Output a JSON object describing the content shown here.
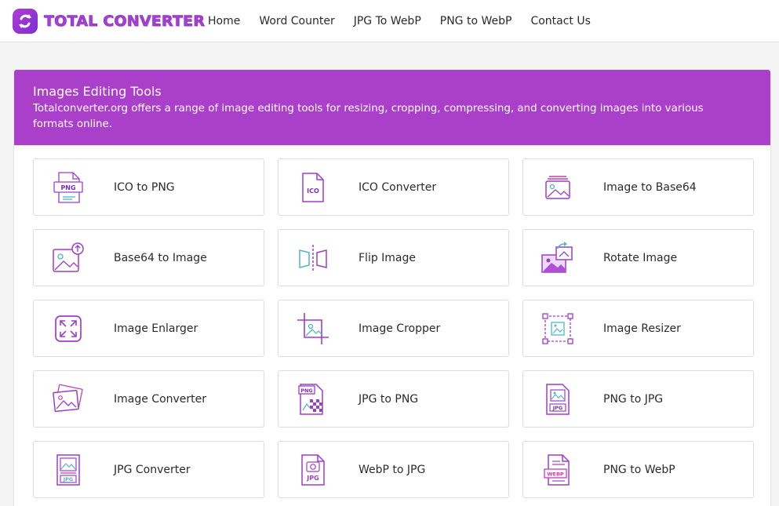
{
  "brand": {
    "name": "TOTAL CONVERTER"
  },
  "nav": [
    {
      "label": "Home"
    },
    {
      "label": "Word Counter"
    },
    {
      "label": "JPG To WebP"
    },
    {
      "label": "PNG to WebP"
    },
    {
      "label": "Contact Us"
    }
  ],
  "panel": {
    "title": "Images Editing Tools",
    "description": "Totalconverter.org offers a range of image editing tools for resizing, cropping, compressing, and converting images into various formats online."
  },
  "tools": [
    {
      "label": "ICO to PNG",
      "icon": "ico-to-png-icon",
      "badge": "PNG"
    },
    {
      "label": "ICO Converter",
      "icon": "ico-file-icon",
      "badge": "ICO"
    },
    {
      "label": "Image to Base64",
      "icon": "image-stack-icon"
    },
    {
      "label": "Base64 to Image",
      "icon": "image-upload-icon"
    },
    {
      "label": "Flip Image",
      "icon": "flip-icon"
    },
    {
      "label": "Rotate Image",
      "icon": "rotate-image-icon"
    },
    {
      "label": "Image Enlarger",
      "icon": "expand-icon"
    },
    {
      "label": "Image Cropper",
      "icon": "crop-icon"
    },
    {
      "label": "Image Resizer",
      "icon": "resize-icon"
    },
    {
      "label": "Image Converter",
      "icon": "image-convert-icon"
    },
    {
      "label": "JPG to PNG",
      "icon": "jpg-to-png-icon",
      "badge": "PNG"
    },
    {
      "label": "PNG to JPG",
      "icon": "png-to-jpg-icon",
      "badge": "JPG"
    },
    {
      "label": "JPG Converter",
      "icon": "jpg-converter-icon",
      "badge": "JPG"
    },
    {
      "label": "WebP to JPG",
      "icon": "webp-to-jpg-icon",
      "badge": "JPG"
    },
    {
      "label": "PNG to WebP",
      "icon": "png-to-webp-icon",
      "badge": "WEBP"
    }
  ],
  "colors": {
    "accent": "#aa3fc9",
    "icon_purple": "#8e2fc6",
    "icon_teal": "#4fb6c9"
  }
}
